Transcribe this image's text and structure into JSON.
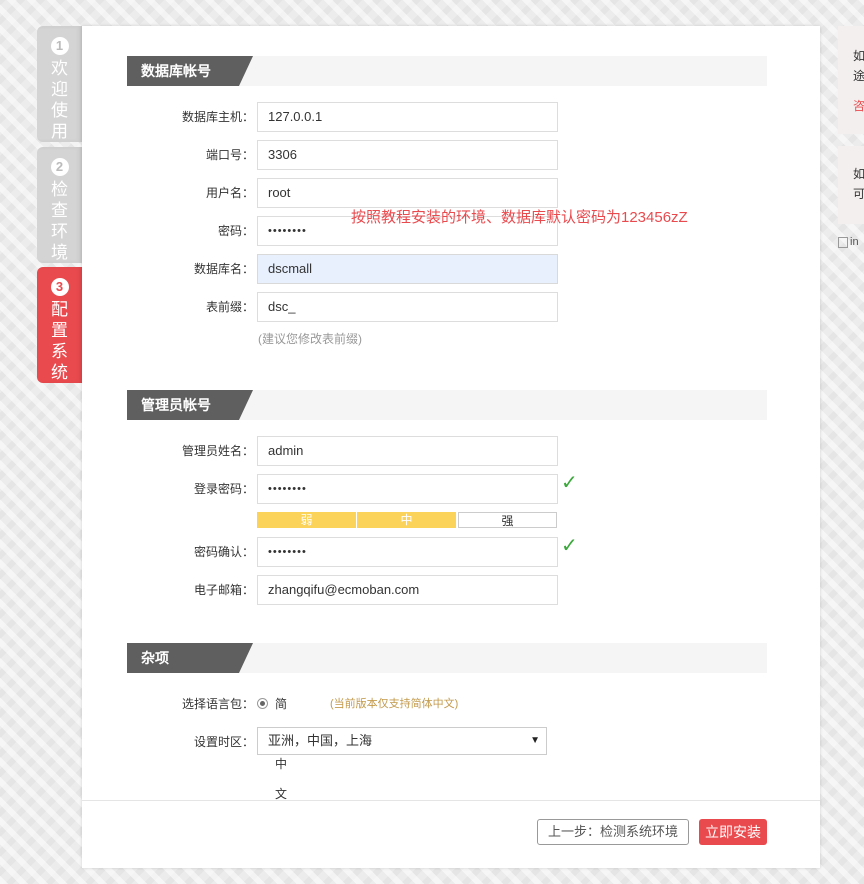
{
  "steps": [
    {
      "num": "1",
      "label": "欢迎使用"
    },
    {
      "num": "2",
      "label": "检查环境"
    },
    {
      "num": "3",
      "label": "配置系统"
    }
  ],
  "db_section": {
    "title": "数据库帐号",
    "host_label": "数据库主机：",
    "host_value": "127.0.0.1",
    "port_label": "端口号：",
    "port_value": "3306",
    "user_label": "用户名：",
    "user_value": "root",
    "password_label": "密码：",
    "password_value": "••••••••",
    "password_hint": "按照教程安装的环境、数据库默认密码为123456zZ",
    "dbname_label": "数据库名：",
    "dbname_value": "dscmall",
    "prefix_label": "表前缀：",
    "prefix_value": "dsc_",
    "prefix_note": "(建议您修改表前缀)"
  },
  "admin_section": {
    "title": "管理员帐号",
    "name_label": "管理员姓名：",
    "name_value": "admin",
    "password_label": "登录密码：",
    "password_value": "••••••••",
    "strength": {
      "weak": "弱",
      "medium": "中",
      "strong": "强",
      "level": "medium"
    },
    "confirm_label": "密码确认：",
    "confirm_value": "••••••••",
    "email_label": "电子邮箱：",
    "email_value": "zhangqifu@ecmoban.com",
    "check_mark": "✓"
  },
  "misc_section": {
    "title": "杂项",
    "lang_label": "选择语言包：",
    "lang_option": "简体中文",
    "lang_note": "(当前版本仅支持简体中文)",
    "timezone_label": "设置时区：",
    "timezone_value": "亚洲，中国，上海"
  },
  "buttons": {
    "prev": "上一步：检测系统环境",
    "install": "立即安装"
  },
  "side": {
    "panel1_line1": "如",
    "panel1_line2": "途",
    "panel1_link": "咨",
    "panel2_line1": "如",
    "panel2_line2": "可",
    "broken_img": "in"
  },
  "colors": {
    "accent": "#e94a4e",
    "strength_fill": "#fcd35a",
    "check": "#3aa83a"
  }
}
